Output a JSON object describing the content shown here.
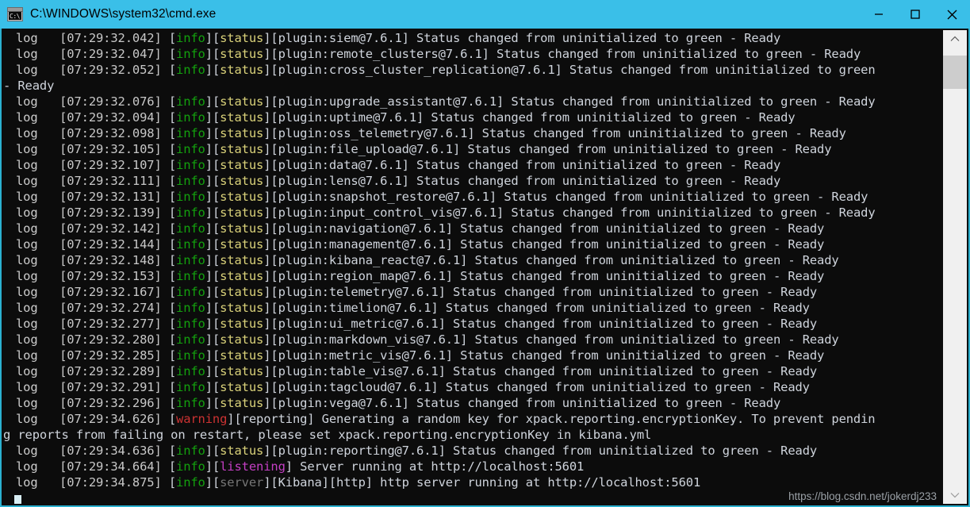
{
  "window": {
    "title": "C:\\WINDOWS\\system32\\cmd.exe",
    "icon_name": "cmd-icon",
    "icon_text": "C:\\",
    "titlebar_color": "#3ABFE8",
    "background_color": "#0c0c0c",
    "border_color": "#2ab0cf"
  },
  "controls": {
    "minimize_label": "Minimize",
    "maximize_label": "Maximize",
    "close_label": "Close"
  },
  "colors": {
    "info": "#13a10e",
    "status": "#dad27a",
    "warning": "#cc3232",
    "listening": "#c43fc4",
    "server": "#767676",
    "text": "#cfd4dc",
    "log": "#cccccc"
  },
  "scrollbar": {
    "up_arrow": "⌃",
    "down_arrow": "⌄",
    "thumb_top_pct": 2,
    "thumb_height_pct": 7
  },
  "watermark": {
    "text": "https://blog.csdn.net/jokerdj233"
  },
  "console": {
    "lines": [
      {
        "type": "log",
        "time": "[07:29:32.042]",
        "level": "info",
        "tag": "status",
        "plugin": "[plugin:siem@7.6.1]",
        "message": " Status changed from uninitialized to green - Ready"
      },
      {
        "type": "log",
        "time": "[07:29:32.047]",
        "level": "info",
        "tag": "status",
        "plugin": "[plugin:remote_clusters@7.6.1]",
        "message": " Status changed from uninitialized to green - Ready"
      },
      {
        "type": "log",
        "time": "[07:29:32.052]",
        "level": "info",
        "tag": "status",
        "plugin": "[plugin:cross_cluster_replication@7.6.1]",
        "message": " Status changed from uninitialized to green"
      },
      {
        "type": "cont",
        "message": "- Ready"
      },
      {
        "type": "log",
        "time": "[07:29:32.076]",
        "level": "info",
        "tag": "status",
        "plugin": "[plugin:upgrade_assistant@7.6.1]",
        "message": " Status changed from uninitialized to green - Ready"
      },
      {
        "type": "log",
        "time": "[07:29:32.094]",
        "level": "info",
        "tag": "status",
        "plugin": "[plugin:uptime@7.6.1]",
        "message": " Status changed from uninitialized to green - Ready"
      },
      {
        "type": "log",
        "time": "[07:29:32.098]",
        "level": "info",
        "tag": "status",
        "plugin": "[plugin:oss_telemetry@7.6.1]",
        "message": " Status changed from uninitialized to green - Ready"
      },
      {
        "type": "log",
        "time": "[07:29:32.105]",
        "level": "info",
        "tag": "status",
        "plugin": "[plugin:file_upload@7.6.1]",
        "message": " Status changed from uninitialized to green - Ready"
      },
      {
        "type": "log",
        "time": "[07:29:32.107]",
        "level": "info",
        "tag": "status",
        "plugin": "[plugin:data@7.6.1]",
        "message": " Status changed from uninitialized to green - Ready"
      },
      {
        "type": "log",
        "time": "[07:29:32.111]",
        "level": "info",
        "tag": "status",
        "plugin": "[plugin:lens@7.6.1]",
        "message": " Status changed from uninitialized to green - Ready"
      },
      {
        "type": "log",
        "time": "[07:29:32.131]",
        "level": "info",
        "tag": "status",
        "plugin": "[plugin:snapshot_restore@7.6.1]",
        "message": " Status changed from uninitialized to green - Ready"
      },
      {
        "type": "log",
        "time": "[07:29:32.139]",
        "level": "info",
        "tag": "status",
        "plugin": "[plugin:input_control_vis@7.6.1]",
        "message": " Status changed from uninitialized to green - Ready"
      },
      {
        "type": "log",
        "time": "[07:29:32.142]",
        "level": "info",
        "tag": "status",
        "plugin": "[plugin:navigation@7.6.1]",
        "message": " Status changed from uninitialized to green - Ready"
      },
      {
        "type": "log",
        "time": "[07:29:32.144]",
        "level": "info",
        "tag": "status",
        "plugin": "[plugin:management@7.6.1]",
        "message": " Status changed from uninitialized to green - Ready"
      },
      {
        "type": "log",
        "time": "[07:29:32.148]",
        "level": "info",
        "tag": "status",
        "plugin": "[plugin:kibana_react@7.6.1]",
        "message": " Status changed from uninitialized to green - Ready"
      },
      {
        "type": "log",
        "time": "[07:29:32.153]",
        "level": "info",
        "tag": "status",
        "plugin": "[plugin:region_map@7.6.1]",
        "message": " Status changed from uninitialized to green - Ready"
      },
      {
        "type": "log",
        "time": "[07:29:32.167]",
        "level": "info",
        "tag": "status",
        "plugin": "[plugin:telemetry@7.6.1]",
        "message": " Status changed from uninitialized to green - Ready"
      },
      {
        "type": "log",
        "time": "[07:29:32.274]",
        "level": "info",
        "tag": "status",
        "plugin": "[plugin:timelion@7.6.1]",
        "message": " Status changed from uninitialized to green - Ready"
      },
      {
        "type": "log",
        "time": "[07:29:32.277]",
        "level": "info",
        "tag": "status",
        "plugin": "[plugin:ui_metric@7.6.1]",
        "message": " Status changed from uninitialized to green - Ready"
      },
      {
        "type": "log",
        "time": "[07:29:32.280]",
        "level": "info",
        "tag": "status",
        "plugin": "[plugin:markdown_vis@7.6.1]",
        "message": " Status changed from uninitialized to green - Ready"
      },
      {
        "type": "log",
        "time": "[07:29:32.285]",
        "level": "info",
        "tag": "status",
        "plugin": "[plugin:metric_vis@7.6.1]",
        "message": " Status changed from uninitialized to green - Ready"
      },
      {
        "type": "log",
        "time": "[07:29:32.289]",
        "level": "info",
        "tag": "status",
        "plugin": "[plugin:table_vis@7.6.1]",
        "message": " Status changed from uninitialized to green - Ready"
      },
      {
        "type": "log",
        "time": "[07:29:32.291]",
        "level": "info",
        "tag": "status",
        "plugin": "[plugin:tagcloud@7.6.1]",
        "message": " Status changed from uninitialized to green - Ready"
      },
      {
        "type": "log",
        "time": "[07:29:32.296]",
        "level": "info",
        "tag": "status",
        "plugin": "[plugin:vega@7.6.1]",
        "message": " Status changed from uninitialized to green - Ready"
      },
      {
        "type": "log",
        "time": "[07:29:34.626]",
        "level": "warning",
        "tag": null,
        "plugin": "[reporting]",
        "message": " Generating a random key for xpack.reporting.encryptionKey. To prevent pendin"
      },
      {
        "type": "cont",
        "message": "g reports from failing on restart, please set xpack.reporting.encryptionKey in kibana.yml"
      },
      {
        "type": "log",
        "time": "[07:29:34.636]",
        "level": "info",
        "tag": "status",
        "plugin": "[plugin:reporting@7.6.1]",
        "message": " Status changed from uninitialized to green - Ready"
      },
      {
        "type": "log",
        "time": "[07:29:34.664]",
        "level": "info",
        "tag": "listening",
        "plugin": "",
        "message": " Server running at http://localhost:5601"
      },
      {
        "type": "log",
        "time": "[07:29:34.875]",
        "level": "info",
        "tag": "server",
        "plugin": "[Kibana][http]",
        "message": " http server running at http://localhost:5601"
      }
    ]
  }
}
